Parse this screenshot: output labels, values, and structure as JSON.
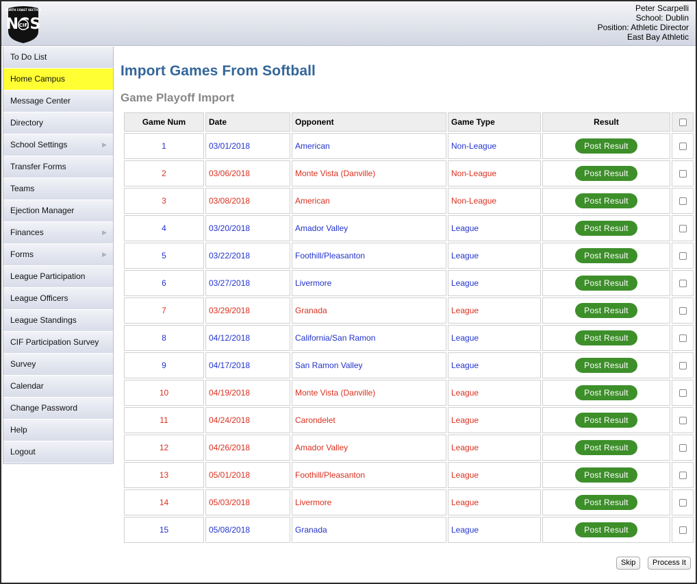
{
  "user": {
    "name": "Peter Scarpelli",
    "school": "School: Dublin",
    "position": "Position: Athletic Director",
    "league": "East Bay Athletic"
  },
  "logo": {
    "text": "NCS CIF",
    "ring_text": "NORTH COAST SECTION"
  },
  "sidebar": {
    "items": [
      {
        "label": "To Do List",
        "active": false,
        "submenu": false
      },
      {
        "label": "Home Campus",
        "active": true,
        "submenu": false
      },
      {
        "label": "Message Center",
        "active": false,
        "submenu": false
      },
      {
        "label": "Directory",
        "active": false,
        "submenu": false
      },
      {
        "label": "School Settings",
        "active": false,
        "submenu": true
      },
      {
        "label": "Transfer Forms",
        "active": false,
        "submenu": false
      },
      {
        "label": "Teams",
        "active": false,
        "submenu": false
      },
      {
        "label": "Ejection Manager",
        "active": false,
        "submenu": false
      },
      {
        "label": "Finances",
        "active": false,
        "submenu": true
      },
      {
        "label": "Forms",
        "active": false,
        "submenu": true
      },
      {
        "label": "League Participation",
        "active": false,
        "submenu": false
      },
      {
        "label": "League Officers",
        "active": false,
        "submenu": false
      },
      {
        "label": "League Standings",
        "active": false,
        "submenu": false
      },
      {
        "label": "CIF Participation Survey",
        "active": false,
        "submenu": false
      },
      {
        "label": "Survey",
        "active": false,
        "submenu": false
      },
      {
        "label": "Calendar",
        "active": false,
        "submenu": false
      },
      {
        "label": "Change Password",
        "active": false,
        "submenu": false
      },
      {
        "label": "Help",
        "active": false,
        "submenu": false
      },
      {
        "label": "Logout",
        "active": false,
        "submenu": false
      }
    ]
  },
  "page": {
    "title": "Import Games From Softball",
    "section": "Game Playoff Import"
  },
  "table": {
    "headers": {
      "game_num": "Game Num",
      "date": "Date",
      "opponent": "Opponent",
      "game_type": "Game Type",
      "result": "Result"
    },
    "post_label": "Post Result",
    "rows": [
      {
        "num": "1",
        "date": "03/01/2018",
        "opponent": "American",
        "type": "Non-League",
        "color": "blue"
      },
      {
        "num": "2",
        "date": "03/06/2018",
        "opponent": "Monte Vista (Danville)",
        "type": "Non-League",
        "color": "red"
      },
      {
        "num": "3",
        "date": "03/08/2018",
        "opponent": "American",
        "type": "Non-League",
        "color": "red"
      },
      {
        "num": "4",
        "date": "03/20/2018",
        "opponent": "Amador Valley",
        "type": "League",
        "color": "blue"
      },
      {
        "num": "5",
        "date": "03/22/2018",
        "opponent": "Foothill/Pleasanton",
        "type": "League",
        "color": "blue"
      },
      {
        "num": "6",
        "date": "03/27/2018",
        "opponent": "Livermore",
        "type": "League",
        "color": "blue"
      },
      {
        "num": "7",
        "date": "03/29/2018",
        "opponent": "Granada",
        "type": "League",
        "color": "red"
      },
      {
        "num": "8",
        "date": "04/12/2018",
        "opponent": "California/San Ramon",
        "type": "League",
        "color": "blue"
      },
      {
        "num": "9",
        "date": "04/17/2018",
        "opponent": "San Ramon Valley",
        "type": "League",
        "color": "blue"
      },
      {
        "num": "10",
        "date": "04/19/2018",
        "opponent": "Monte Vista (Danville)",
        "type": "League",
        "color": "red"
      },
      {
        "num": "11",
        "date": "04/24/2018",
        "opponent": "Carondelet",
        "type": "League",
        "color": "red"
      },
      {
        "num": "12",
        "date": "04/26/2018",
        "opponent": "Amador Valley",
        "type": "League",
        "color": "red"
      },
      {
        "num": "13",
        "date": "05/01/2018",
        "opponent": "Foothill/Pleasanton",
        "type": "League",
        "color": "red"
      },
      {
        "num": "14",
        "date": "05/03/2018",
        "opponent": "Livermore",
        "type": "League",
        "color": "red"
      },
      {
        "num": "15",
        "date": "05/08/2018",
        "opponent": "Granada",
        "type": "League",
        "color": "blue"
      }
    ]
  },
  "actions": {
    "skip_label": "Skip",
    "process_label": "Process It"
  },
  "colors": {
    "win": "#2233cc",
    "loss": "#d9301f",
    "button": "#3d8f2a",
    "active_nav": "#ffff33",
    "title": "#336699"
  }
}
